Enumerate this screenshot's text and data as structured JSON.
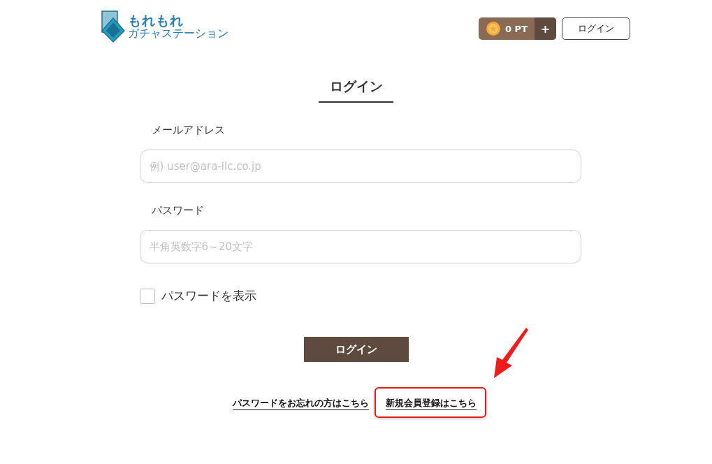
{
  "header": {
    "logo": {
      "line_1": "もれもれ",
      "line_2": "ガチャステーション"
    },
    "points": {
      "value": "0 PT",
      "add": "+"
    },
    "login_button": "ログイン"
  },
  "page_title": "ログイン",
  "fields": [
    {
      "label": "メールアドレス",
      "placeholder": "例) user@ara-llc.co.jp"
    },
    {
      "label": "パスワード",
      "placeholder": "半角英数字6～20文字"
    }
  ],
  "show_password": {
    "label": "パスワードを表示",
    "checked": false
  },
  "submit": "ログイン",
  "links": [
    {
      "text": "パスワードをお忘れの方はこちら",
      "highlighted": false
    },
    {
      "text": "新規会員登録はこちら",
      "highlighted": true
    }
  ]
}
